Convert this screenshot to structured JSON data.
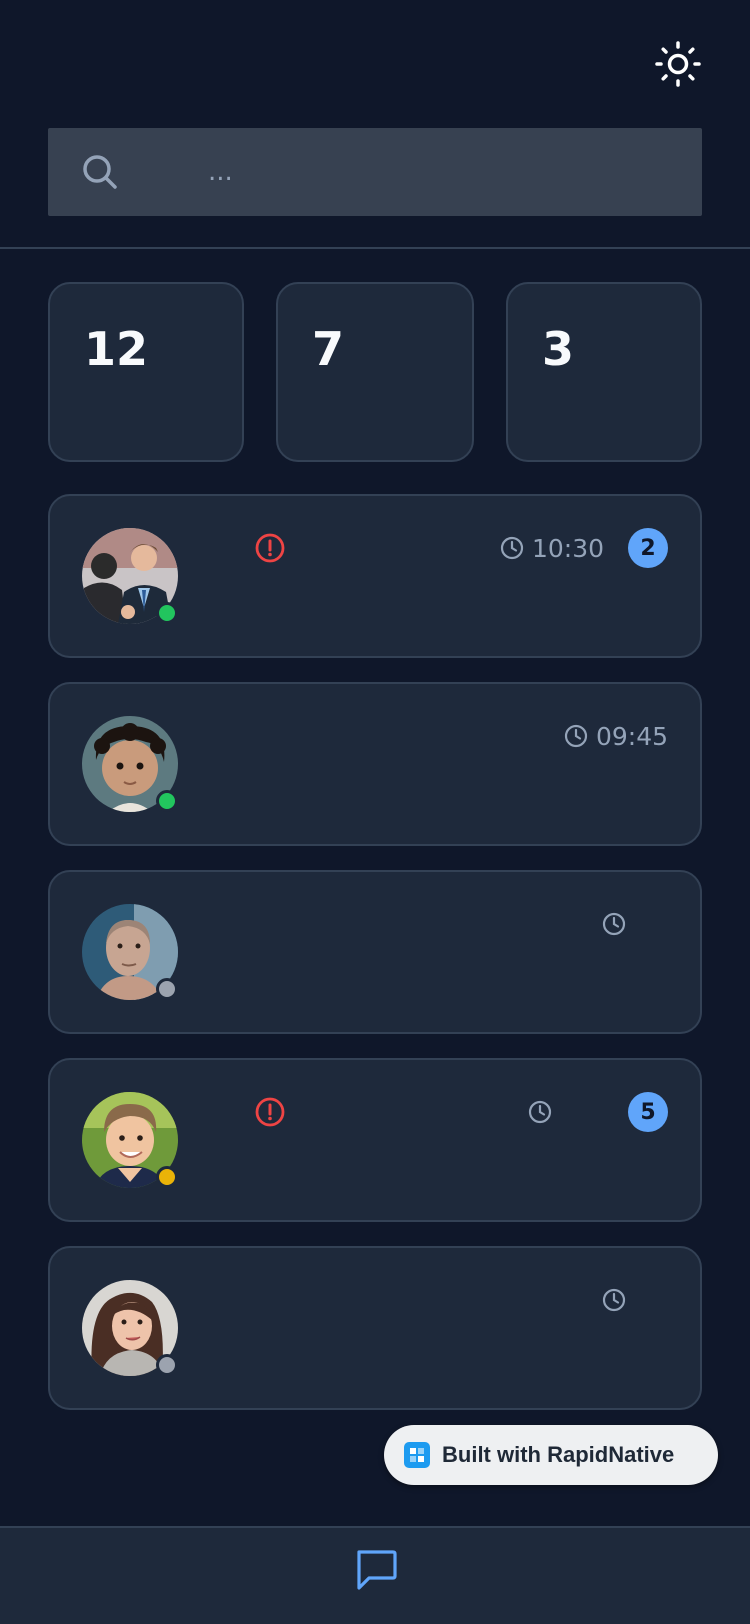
{
  "search": {
    "placeholder": "..."
  },
  "stats": [
    {
      "value": "12"
    },
    {
      "value": "7"
    },
    {
      "value": "3"
    }
  ],
  "conversations": [
    {
      "time": "10:30",
      "unread": "2",
      "status": "online",
      "alert": true
    },
    {
      "time": "09:45",
      "unread": "",
      "status": "online",
      "alert": false
    },
    {
      "time": "",
      "unread": "",
      "status": "offline",
      "alert": false
    },
    {
      "time": "",
      "unread": "5",
      "status": "away",
      "alert": true
    },
    {
      "time": "",
      "unread": "",
      "status": "offline",
      "alert": false
    }
  ],
  "branding": {
    "label": "Built with RapidNative"
  },
  "colors": {
    "background": "#0f172a",
    "card": "#1e293b",
    "border": "#334155",
    "accent": "#60a5fa",
    "online": "#22c55e",
    "away": "#eab308",
    "offline": "#9ca3af",
    "alert": "#ef4444"
  },
  "icons": {
    "theme": "sun-icon",
    "search": "search-icon",
    "time": "clock-icon",
    "alert": "alert-circle-icon",
    "tab": "chat-bubble-icon"
  }
}
